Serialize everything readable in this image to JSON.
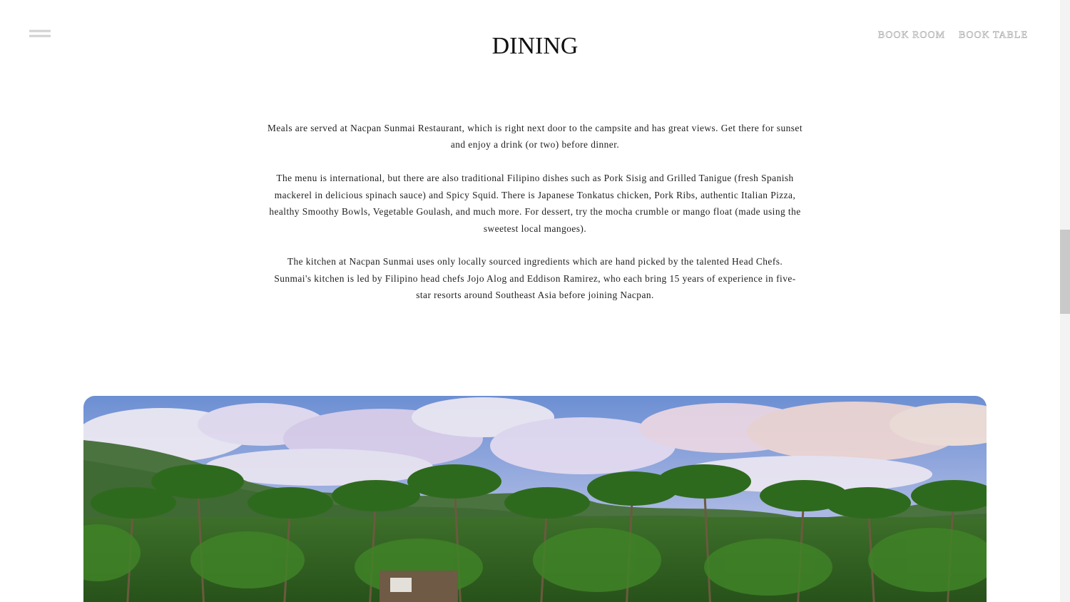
{
  "header": {
    "menu_icon": "hamburger-menu-icon",
    "title": "DINING",
    "links": [
      {
        "label": "BOOK ROOM"
      },
      {
        "label": "BOOK TABLE"
      }
    ]
  },
  "content": {
    "paragraphs": [
      "Meals are served at Nacpan Sunmai Restaurant, which is right next door to the campsite and has great views. Get there for sunset and enjoy a drink (or two) before dinner.",
      "The menu is international, but there are also traditional Filipino dishes such as Pork Sisig and Grilled Tanigue (fresh Spanish mackerel in delicious spinach sauce) and Spicy Squid. There is Japanese Tonkatus chicken, Pork Ribs, authentic Italian Pizza, healthy Smoothy Bowls, Vegetable Goulash, and much more. For dessert, try the mocha crumble or mango float (made using the sweetest local mangoes).",
      "The kitchen at Nacpan Sunmai uses only locally sourced ingredients which are hand picked by the talented Head Chefs. Sunmai's kitchen is led by Filipino head chefs Jojo Alog and Eddison Ramirez, who each bring 15 years of experience in five-star resorts around Southeast Asia before joining Nacpan."
    ]
  },
  "hero_image": {
    "subject": "palm trees below mountains and cloudy sky",
    "colors": {
      "sky_top": "#6f93d6",
      "cloud": "#efe8f2",
      "mountain": "#3e6b3a",
      "palm": "#2f6a1f"
    }
  }
}
